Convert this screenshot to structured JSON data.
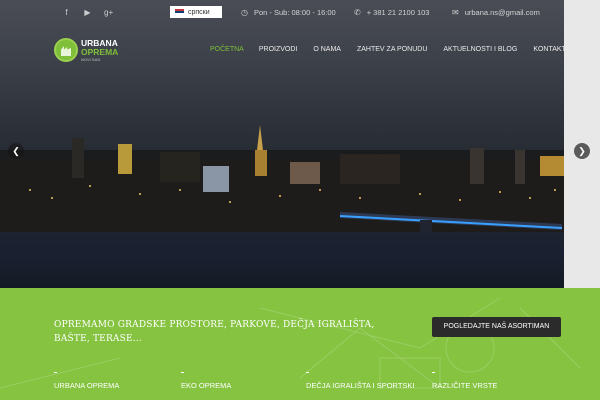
{
  "topbar": {
    "social_icons": [
      "facebook-icon",
      "youtube-icon",
      "google-plus-icon"
    ],
    "language": "српски",
    "hours_icon": "clock-icon",
    "hours": "Pon - Sub: 08:00 - 16:00",
    "phone_icon": "phone-icon",
    "phone": "+ 381 21 2100 103",
    "email_icon": "envelope-icon",
    "email": "urbana.ns@gmail.com"
  },
  "logo": {
    "line1": "URBANA",
    "line2": "OPREMA",
    "tagline": "NOVI SAD"
  },
  "nav": {
    "items": [
      "POČETNA",
      "PROIZVODI",
      "O NAMA",
      "ZAHTEV ZA PONUDU",
      "AKTUELNOSTI I BLOG",
      "KONTAKT"
    ],
    "active": "POČETNA"
  },
  "slider": {
    "prev_icon": "chevron-left-icon",
    "next_icon": "chevron-right-icon"
  },
  "band": {
    "title": "OPREMAMO GRADSKE PROSTORE, PARKOVE, DEČJA IGRALIŠTA, BAŠTE, TERASE...",
    "cta": "POGLEDAJTE NAŠ ASORTIMAN",
    "categories": [
      "URBANA OPREMA",
      "EKO OPREMA",
      "DEČJA IGRALIŠTA I SPORTSKI",
      "RAZLIČITE VRSTE"
    ]
  },
  "colors": {
    "accent": "#7fbf3a",
    "band": "#85c341",
    "cta_bg": "#2b2b2b"
  }
}
